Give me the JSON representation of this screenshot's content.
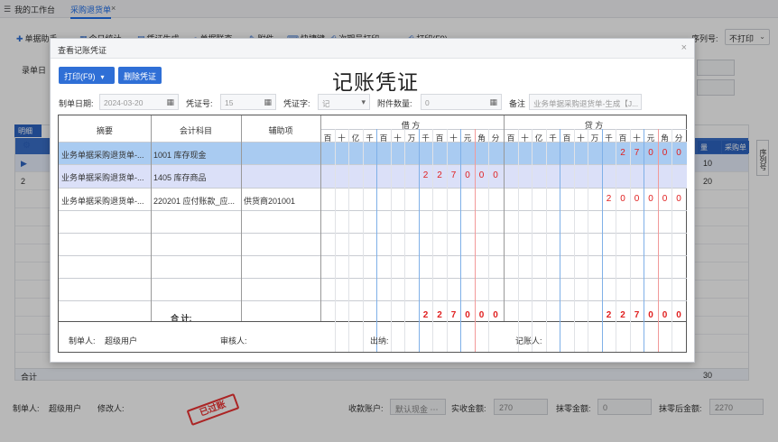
{
  "topbar": {
    "tabs": [
      "我的工作台",
      "采购退货单"
    ],
    "close": "×"
  },
  "toolbar": {
    "items": [
      "单据助手",
      "今日统计",
      "凭证生成",
      "单据联查",
      "附件",
      "快捷键",
      "次期号打印",
      "打印(F9)"
    ],
    "series_label": "序列号:",
    "series_value": "不打印"
  },
  "background": {
    "labels": [
      "录单日",
      "明细",
      "合计",
      "量",
      "采购单",
      "序列号"
    ],
    "rows": [
      "1",
      "2"
    ],
    "qty": [
      "10",
      "20"
    ],
    "total_qty": "30"
  },
  "bottom": {
    "maker_label": "制单人:",
    "maker": "超级用户",
    "modifier_label": "修改人:",
    "account_label": "收款账户:",
    "account_placeholder": "默认现金",
    "received_label": "实收金额:",
    "received": "270",
    "discount_label": "抹零金额:",
    "discount": "0",
    "after_label": "抹零后金额:",
    "after": "2270",
    "stamp": "已过账"
  },
  "modal": {
    "title": "查看记账凭证",
    "close": "×",
    "print_btn": "打印(F9)",
    "delete_btn": "删除凭证",
    "voucher_title": "记账凭证",
    "date_label": "制单日期:",
    "date": "2024-03-20",
    "no_label": "凭证号:",
    "no": "15",
    "word_label": "凭证字:",
    "word": "记",
    "attach_label": "附件数量:",
    "attach": "0",
    "note_label": "备注",
    "note": "业务单据采购退货单-生成【J..."
  },
  "table": {
    "headers": {
      "summary": "摘要",
      "subject": "会计科目",
      "aux": "辅助项",
      "debit": "借 方",
      "credit": "贷 方"
    },
    "digit_units": [
      "百",
      "十",
      "亿",
      "千",
      "百",
      "十",
      "万",
      "千",
      "百",
      "十",
      "元",
      "角",
      "分"
    ],
    "rows": [
      {
        "summary": "业务单据采购退货单-...",
        "subject": "1001 库存现金",
        "aux": "",
        "debit": "",
        "credit": "27000"
      },
      {
        "summary": "业务单据采购退货单-...",
        "subject": "1405 库存商品",
        "aux": "",
        "debit": "227000",
        "credit": ""
      },
      {
        "summary": "业务单据采购退货单-...",
        "subject": "220201 应付账款_应...",
        "aux": "供货商201001",
        "debit": "",
        "credit": "200000"
      }
    ],
    "total_label": "合    计:",
    "total_debit": "227000",
    "total_credit": "227000"
  },
  "signs": {
    "maker_label": "制单人:",
    "maker": "超级用户",
    "auditor_label": "审核人:",
    "cashier_label": "出纳:",
    "bookkeeper_label": "记账人:"
  }
}
